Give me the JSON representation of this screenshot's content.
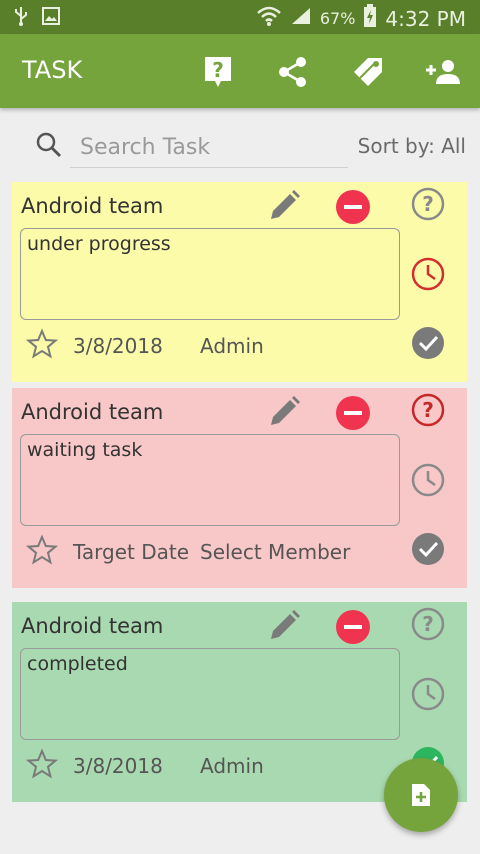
{
  "status_bar": {
    "battery": "67%",
    "time": "4:32 PM"
  },
  "app_bar": {
    "title": "TASK"
  },
  "search": {
    "placeholder": "Search Task",
    "sort_label": "Sort by: All"
  },
  "tasks": [
    {
      "title": "Android team",
      "note": "under progress",
      "date": "3/8/2018",
      "member": "Admin",
      "bg": "#fbfba9",
      "question_color": "#8a8a8a",
      "clock_color": "#d32f2f",
      "check_color": "#7a7a7a"
    },
    {
      "title": "Android team",
      "note": "waiting task",
      "date": "Target Date",
      "member": "Select Member",
      "bg": "#f8c7c7",
      "question_color": "#c62828",
      "clock_color": "#8a8a8a",
      "check_color": "#7a7a7a"
    },
    {
      "title": "Android team",
      "note": "completed",
      "date": "3/8/2018",
      "member": "Admin",
      "bg": "#a9d9b0",
      "question_color": "#8a8a8a",
      "clock_color": "#8a8a8a",
      "check_color": "#2eb560"
    }
  ],
  "colors": {
    "status_bar": "#5a7f2a",
    "app_bar": "#76a43c",
    "accent_red": "#f0344f",
    "fab": "#76a43c"
  }
}
